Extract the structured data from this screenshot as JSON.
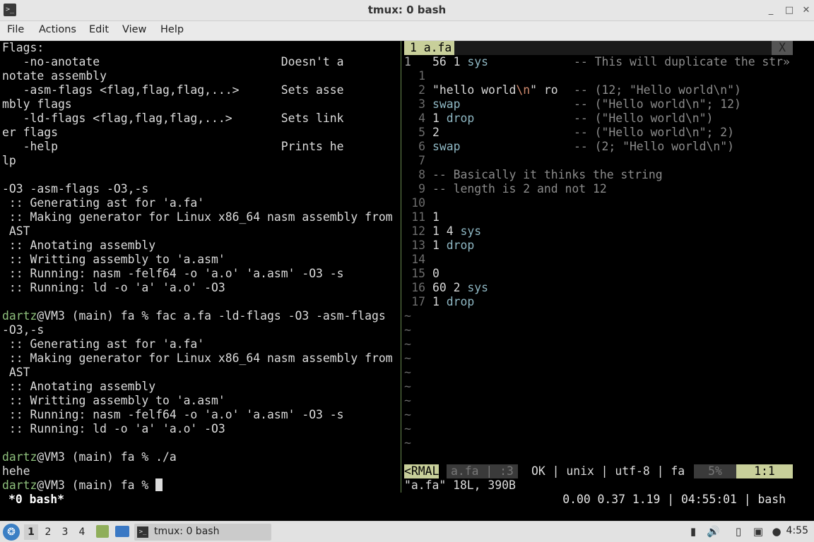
{
  "window": {
    "title": "tmux: 0 bash",
    "minimize": "_",
    "maximize": "□",
    "close": "✕"
  },
  "menu": [
    "File",
    "Actions",
    "Edit",
    "View",
    "Help"
  ],
  "left_pane": {
    "lines": [
      {
        "t": "Flags:"
      },
      {
        "t": "   -no-anotate                          Doesn't a"
      },
      {
        "t": "notate assembly"
      },
      {
        "t": "   -asm-flags <flag,flag,flag,...>      Sets asse"
      },
      {
        "t": "mbly flags"
      },
      {
        "t": "   -ld-flags <flag,flag,flag,...>       Sets link"
      },
      {
        "t": "er flags"
      },
      {
        "t": "   -help                                Prints he"
      },
      {
        "t": "lp"
      },
      {
        "t": ""
      },
      {
        "t": "-O3 -asm-flags -O3,-s"
      },
      {
        "t": " :: Generating ast for 'a.fa'"
      },
      {
        "t": " :: Making generator for Linux x86_64 nasm assembly from"
      },
      {
        "t": " AST"
      },
      {
        "t": " :: Anotating assembly"
      },
      {
        "t": " :: Writting assembly to 'a.asm'"
      },
      {
        "t": " :: Running: nasm -felf64 -o 'a.o' 'a.asm' -O3 -s"
      },
      {
        "t": " :: Running: ld -o 'a' 'a.o' -O3"
      },
      {
        "t": ""
      },
      {
        "u": "dartz",
        "t": "@VM3 (main) fa % fac a.fa -ld-flags -O3 -asm-flags"
      },
      {
        "t": "-O3,-s"
      },
      {
        "t": " :: Generating ast for 'a.fa'"
      },
      {
        "t": " :: Making generator for Linux x86_64 nasm assembly from"
      },
      {
        "t": " AST"
      },
      {
        "t": " :: Anotating assembly"
      },
      {
        "t": " :: Writting assembly to 'a.asm'"
      },
      {
        "t": " :: Running: nasm -felf64 -o 'a.o' 'a.asm' -O3 -s"
      },
      {
        "t": " :: Running: ld -o 'a' 'a.o' -O3"
      },
      {
        "t": ""
      },
      {
        "u": "dartz",
        "t": "@VM3 (main) fa % ./a"
      },
      {
        "t": "hehe"
      },
      {
        "u": "dartz",
        "t": "@VM3 (main) fa % "
      }
    ]
  },
  "vim": {
    "tab_label": "1 a.fa",
    "tab_close": "X",
    "lines": [
      {
        "n": "1",
        "cur": true,
        "code": "56 1 ",
        "kw": "sys",
        "cmt": "-- This will duplicate the str»"
      },
      {
        "n": "1"
      },
      {
        "n": "2",
        "code_pre": "\"hello world",
        "esc": "\\n",
        "code_post": "\" ro",
        "cmt": "-- (12; \"Hello world\\n\")"
      },
      {
        "n": "3",
        "kw_only": "swap",
        "cmt": "-- (\"Hello world\\n\"; 12)"
      },
      {
        "n": "4",
        "code": "1 ",
        "kw": "drop",
        "cmt": "-- (\"Hello world\\n\")"
      },
      {
        "n": "5",
        "code": "2",
        "cmt": "-- (\"Hello world\\n\"; 2)"
      },
      {
        "n": "6",
        "kw_only": "swap",
        "cmt": "-- (2; \"Hello world\\n\")"
      },
      {
        "n": "7"
      },
      {
        "n": "8",
        "gray": "-- Basically it thinks the string"
      },
      {
        "n": "9",
        "gray": "-- length is 2 and not 12"
      },
      {
        "n": "10"
      },
      {
        "n": "11",
        "code": "1"
      },
      {
        "n": "12",
        "code": "1 4 ",
        "kw": "sys"
      },
      {
        "n": "13",
        "code": "1 ",
        "kw": "drop"
      },
      {
        "n": "14"
      },
      {
        "n": "15",
        "code": "0"
      },
      {
        "n": "16",
        "code": "60 2 ",
        "kw": "sys"
      },
      {
        "n": "17",
        "code": "1 ",
        "kw": "drop"
      }
    ],
    "tilde": "~",
    "tilde_count": 10,
    "status": {
      "mode": "<RMAL",
      "file": "a.fa | :3",
      "info": "OK | unix | utf-8 | fa",
      "percent": "5%",
      "position": "1:1"
    },
    "cmdline": "\"a.fa\" 18L, 390B"
  },
  "tmux": {
    "window": "*0 bash*",
    "right": "0.00 0.37 1.19 | 04:55:01 | bash"
  },
  "taskbar": {
    "workspaces": [
      "1",
      "2",
      "3",
      "4"
    ],
    "active_workspace": "1",
    "task_label": "tmux: 0 bash",
    "clock": "4:55"
  }
}
